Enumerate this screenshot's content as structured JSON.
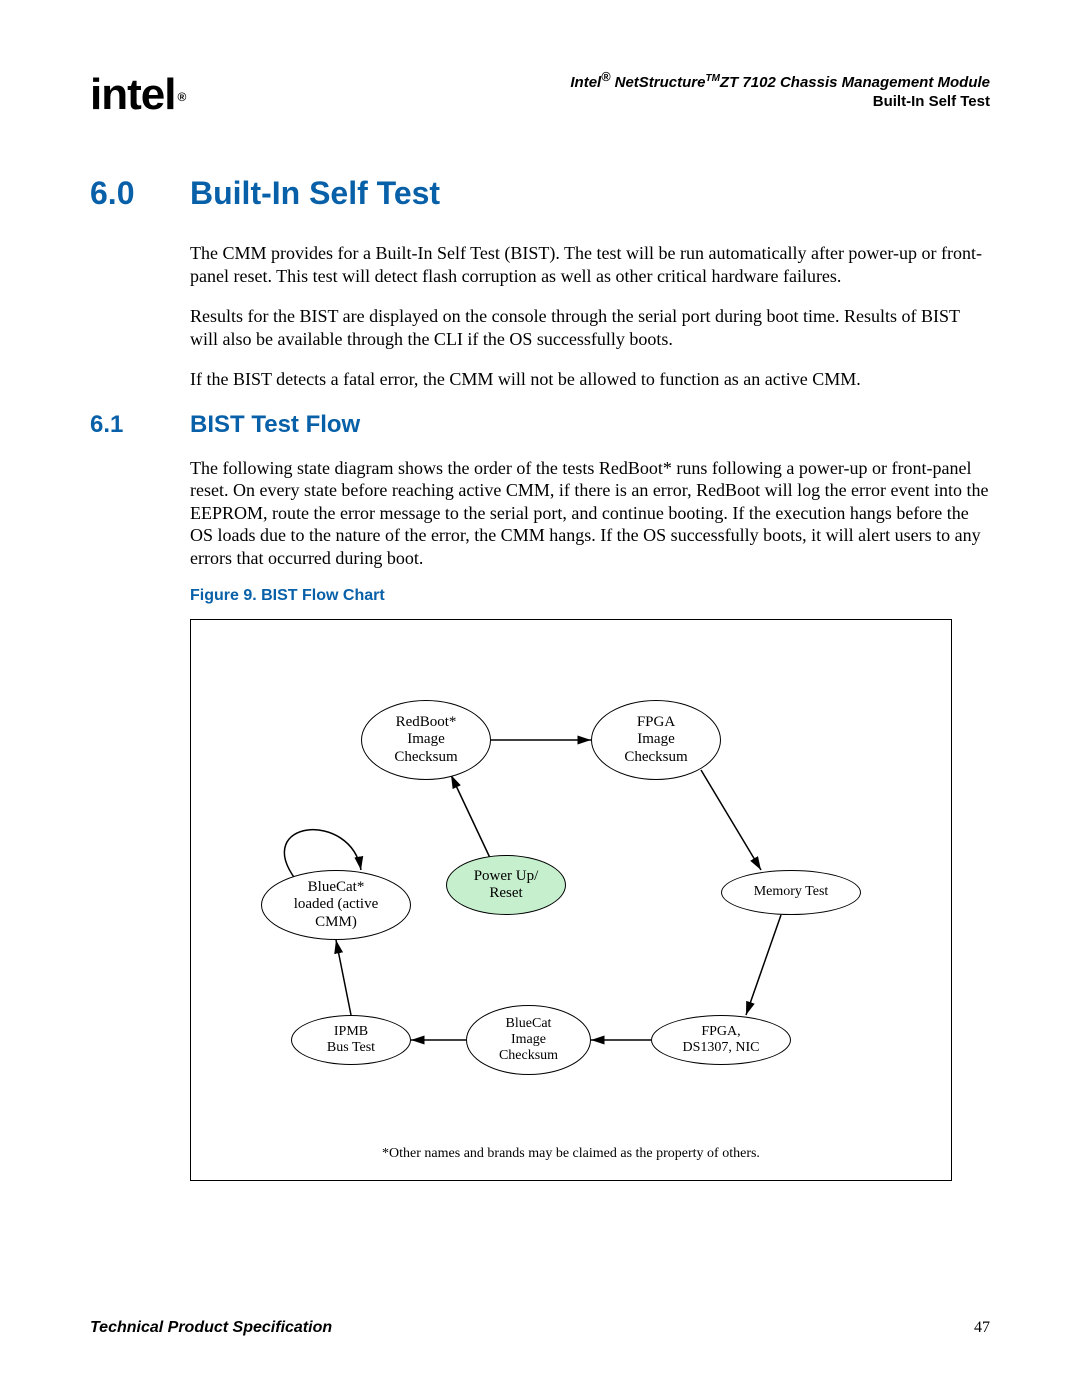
{
  "header": {
    "logo_text": "intel",
    "logo_reg": "®",
    "title_line1_prefix": "Intel",
    "title_line1_reg": "®",
    "title_line1_mid": " NetStructure",
    "title_line1_tm": "TM",
    "title_line1_suffix": "ZT 7102 Chassis Management Module",
    "title_line2": "Built-In Self Test"
  },
  "section": {
    "num": "6.0",
    "title": "Built-In Self Test",
    "para1": "The CMM provides for a Built-In Self Test (BIST). The test will be run automatically after power-up or front-panel reset. This test will detect flash corruption as well as other critical hardware failures.",
    "para2": "Results for the BIST are displayed on the console through the serial port during boot time. Results of BIST will also be available through the CLI if the OS successfully boots.",
    "para3": "If the BIST detects a fatal error, the CMM will not be allowed to function as an active CMM."
  },
  "subsection": {
    "num": "6.1",
    "title": "BIST Test Flow",
    "para1": "The following state diagram shows the order of the tests RedBoot* runs following a power-up or front-panel reset. On every state before reaching active CMM, if there is an error, RedBoot will log the error event into the EEPROM, route the error message to the serial port, and continue booting. If the execution hangs before the OS loads due to the nature of the error, the CMM hangs. If the OS successfully boots, it will alert users to any errors that occurred during boot."
  },
  "figure": {
    "caption": "Figure 9. BIST Flow Chart",
    "nodes": {
      "redboot": "RedBoot*\nImage\nChecksum",
      "fpga_img": "FPGA\nImage\nChecksum",
      "powerup": "Power Up/\nReset",
      "bluecat_loaded": "BlueCat*\nloaded (active\nCMM)",
      "memtest": "Memory Test",
      "ipmb": "IPMB\nBus Test",
      "bluecat_img": "BlueCat\nImage\nChecksum",
      "fpga_nic": "FPGA,\nDS1307, NIC"
    },
    "footnote": "*Other names and brands may be claimed as the property of others."
  },
  "footer": {
    "left": "Technical Product Specification",
    "right": "47"
  },
  "chart_data": {
    "type": "flowchart",
    "title": "BIST Flow Chart",
    "start_node": "powerup",
    "nodes": [
      {
        "id": "powerup",
        "label": "Power Up/Reset",
        "highlight": true
      },
      {
        "id": "redboot",
        "label": "RedBoot* Image Checksum"
      },
      {
        "id": "fpga_img",
        "label": "FPGA Image Checksum"
      },
      {
        "id": "memtest",
        "label": "Memory Test"
      },
      {
        "id": "fpga_nic",
        "label": "FPGA, DS1307, NIC"
      },
      {
        "id": "bluecat_img",
        "label": "BlueCat Image Checksum"
      },
      {
        "id": "ipmb",
        "label": "IPMB Bus Test"
      },
      {
        "id": "bluecat_loaded",
        "label": "BlueCat* loaded (active CMM)",
        "self_loop": true
      }
    ],
    "edges": [
      {
        "from": "powerup",
        "to": "redboot"
      },
      {
        "from": "redboot",
        "to": "fpga_img"
      },
      {
        "from": "fpga_img",
        "to": "memtest"
      },
      {
        "from": "memtest",
        "to": "fpga_nic"
      },
      {
        "from": "fpga_nic",
        "to": "bluecat_img"
      },
      {
        "from": "bluecat_img",
        "to": "ipmb"
      },
      {
        "from": "ipmb",
        "to": "bluecat_loaded"
      },
      {
        "from": "bluecat_loaded",
        "to": "bluecat_loaded"
      }
    ]
  }
}
